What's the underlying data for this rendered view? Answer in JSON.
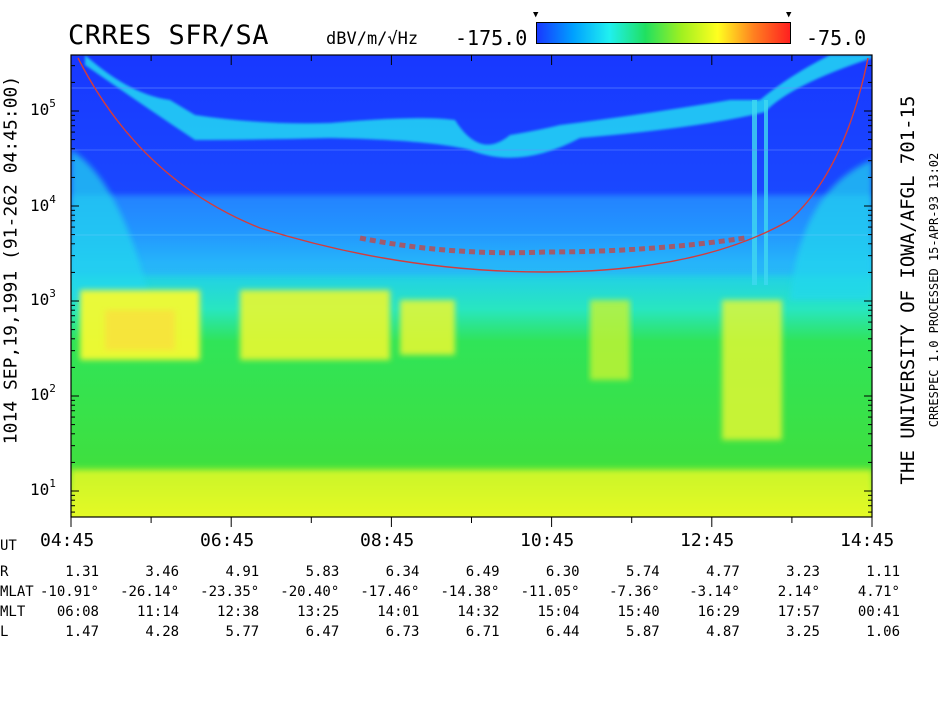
{
  "header": {
    "title": "CRRES SFR/SA",
    "units": "dBV/m/√Hz",
    "scale_min": "-175.0",
    "scale_max": "-75.0"
  },
  "left_label": "1014   SEP,19,1991   (91-262 04:45:00)",
  "right_label": "THE UNIVERSITY OF IOWA/AFGL 701-15",
  "right_label_small": "CRRESPEC 1.0  PROCESSED 15-APR-93  13:02",
  "colors": {
    "bg_blue": "#1a3cff",
    "cyan": "#22e0f0",
    "green": "#29e44a",
    "yellow": "#ffff2c",
    "red_curve": "#d43c3c"
  },
  "chart_data": {
    "type": "heatmap",
    "title": "CRRES SFR/SA",
    "colorbar": {
      "label": "dBV/m/√Hz",
      "min": -175.0,
      "max": -75.0,
      "colors": [
        "#1838ff",
        "#00a0ff",
        "#20f0f0",
        "#20e060",
        "#a0f020",
        "#ffff20",
        "#ff8020",
        "#ff2020"
      ]
    },
    "y_axis": {
      "scale": "log",
      "ticks": [
        "10^1",
        "10^2",
        "10^3",
        "10^4",
        "10^5"
      ],
      "range": [
        6,
        400000
      ]
    },
    "x_axis": {
      "ticks": [
        "04:45",
        "06:45",
        "08:45",
        "10:45",
        "12:45",
        "14:45"
      ]
    },
    "upper_hybrid_line": [
      [
        "04:45",
        340000
      ],
      [
        "05:15",
        160000
      ],
      [
        "05:45",
        60000
      ],
      [
        "06:45",
        48000
      ],
      [
        "07:45",
        50000
      ],
      [
        "08:45",
        55000
      ],
      [
        "09:45",
        32000
      ],
      [
        "10:45",
        55000
      ],
      [
        "11:45",
        70000
      ],
      [
        "12:45",
        90000
      ],
      [
        "13:15",
        160000
      ],
      [
        "14:45",
        400000
      ]
    ],
    "gyrofrequency_curve": [
      [
        "04:45",
        380000
      ],
      [
        "06:45",
        10000
      ],
      [
        "08:45",
        4200
      ],
      [
        "10:45",
        3400
      ],
      [
        "12:45",
        4500
      ],
      [
        "14:45",
        380000
      ]
    ]
  },
  "ephemeris": {
    "rows": [
      {
        "label": "UT",
        "values": [
          "04:45",
          "",
          "06:45",
          "",
          "08:45",
          "",
          "10:45",
          "",
          "12:45",
          "",
          "14:45"
        ]
      },
      {
        "label": "R",
        "values": [
          "1.31",
          "3.46",
          "4.91",
          "5.83",
          "6.34",
          "6.49",
          "6.30",
          "5.74",
          "4.77",
          "3.23",
          "1.11"
        ]
      },
      {
        "label": "MLAT",
        "values": [
          "-10.91°",
          "-26.14°",
          "-23.35°",
          "-20.40°",
          "-17.46°",
          "-14.38°",
          "-11.05°",
          "-7.36°",
          "-3.14°",
          "2.14°",
          "4.71°"
        ]
      },
      {
        "label": "MLT",
        "values": [
          "06:08",
          "11:14",
          "12:38",
          "13:25",
          "14:01",
          "14:32",
          "15:04",
          "15:40",
          "16:29",
          "17:57",
          "00:41"
        ]
      },
      {
        "label": "L",
        "values": [
          "1.47",
          "4.28",
          "5.77",
          "6.47",
          "6.73",
          "6.71",
          "6.44",
          "5.87",
          "4.87",
          "3.25",
          "1.06"
        ]
      }
    ]
  }
}
